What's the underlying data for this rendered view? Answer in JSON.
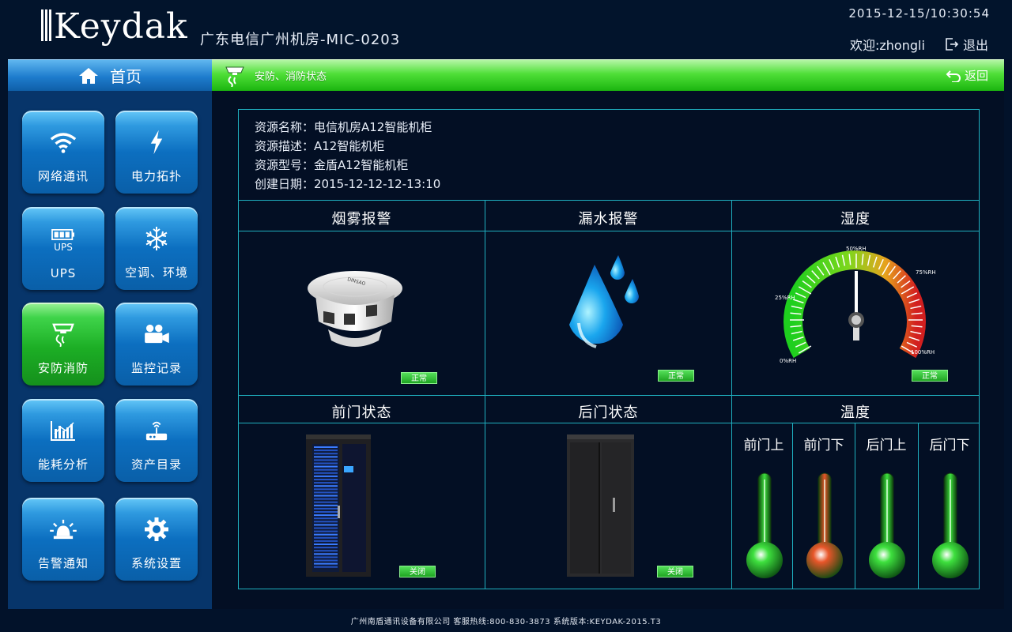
{
  "header": {
    "logo_text": "Keydak",
    "site_title": "广东电信广州机房-MIC-0203",
    "datetime": "2015-12-15/10:30:54",
    "welcome": "欢迎:zhongli",
    "logout_label": "退出"
  },
  "nav": {
    "home_label": "首页",
    "tiles": [
      {
        "label": "网络通讯",
        "icon": "wifi-icon",
        "active": false
      },
      {
        "label": "电力拓扑",
        "icon": "lightning-icon",
        "active": false
      },
      {
        "label": "UPS",
        "icon": "battery-icon",
        "icon_text": "UPS",
        "active": false
      },
      {
        "label": "空调、环境",
        "icon": "snowflake-icon",
        "active": false
      },
      {
        "label": "安防消防",
        "icon": "fire-alarm-icon",
        "active": true
      },
      {
        "label": "监控记录",
        "icon": "camera-icon",
        "active": false
      },
      {
        "label": "能耗分析",
        "icon": "bar-chart-icon",
        "active": false
      },
      {
        "label": "资产目录",
        "icon": "router-icon",
        "active": false
      },
      {
        "label": "告警通知",
        "icon": "siren-icon",
        "active": false
      },
      {
        "label": "系统设置",
        "icon": "gear-icon",
        "active": false
      }
    ]
  },
  "section": {
    "title": "安防、消防状态",
    "back_label": "返回"
  },
  "resource": {
    "name": "资源名称：电信机房A12智能机柜",
    "desc": "资源描述：A12智能机柜",
    "model": "资源型号：金盾A12智能机柜",
    "created": "创建日期：2015-12-12-12-13:10"
  },
  "panels": {
    "smoke": {
      "title": "烟雾报警",
      "status": "正常",
      "device_text": "DINSAO"
    },
    "water": {
      "title": "漏水报警",
      "status": "正常"
    },
    "humidity": {
      "title": "湿度",
      "status": "正常",
      "ticks": {
        "t0": "0%RH",
        "t25": "25%RH",
        "t50": "50%RH",
        "t75": "75%RH",
        "t100": "100%RH"
      },
      "value_pct": 50
    },
    "front_door": {
      "title": "前门状态",
      "status": "关闭"
    },
    "back_door": {
      "title": "后门状态",
      "status": "关闭"
    },
    "temperature": {
      "title": "温度",
      "sensors": [
        {
          "label": "前门上",
          "color": "#3ee03e"
        },
        {
          "label": "前门下",
          "color": "#e8562a"
        },
        {
          "label": "后门上",
          "color": "#3ee03e"
        },
        {
          "label": "后门下",
          "color": "#3ee03e"
        }
      ]
    }
  },
  "footer": {
    "text": "广州南盾通讯设备有限公司 客服热线:800-830-3873 系统版本:KEYDAK-2015.T3"
  },
  "colors": {
    "accent_green": "#1bb50f",
    "tile_blue": "#0c6fc0",
    "grid_line": "#1fb0c0"
  }
}
